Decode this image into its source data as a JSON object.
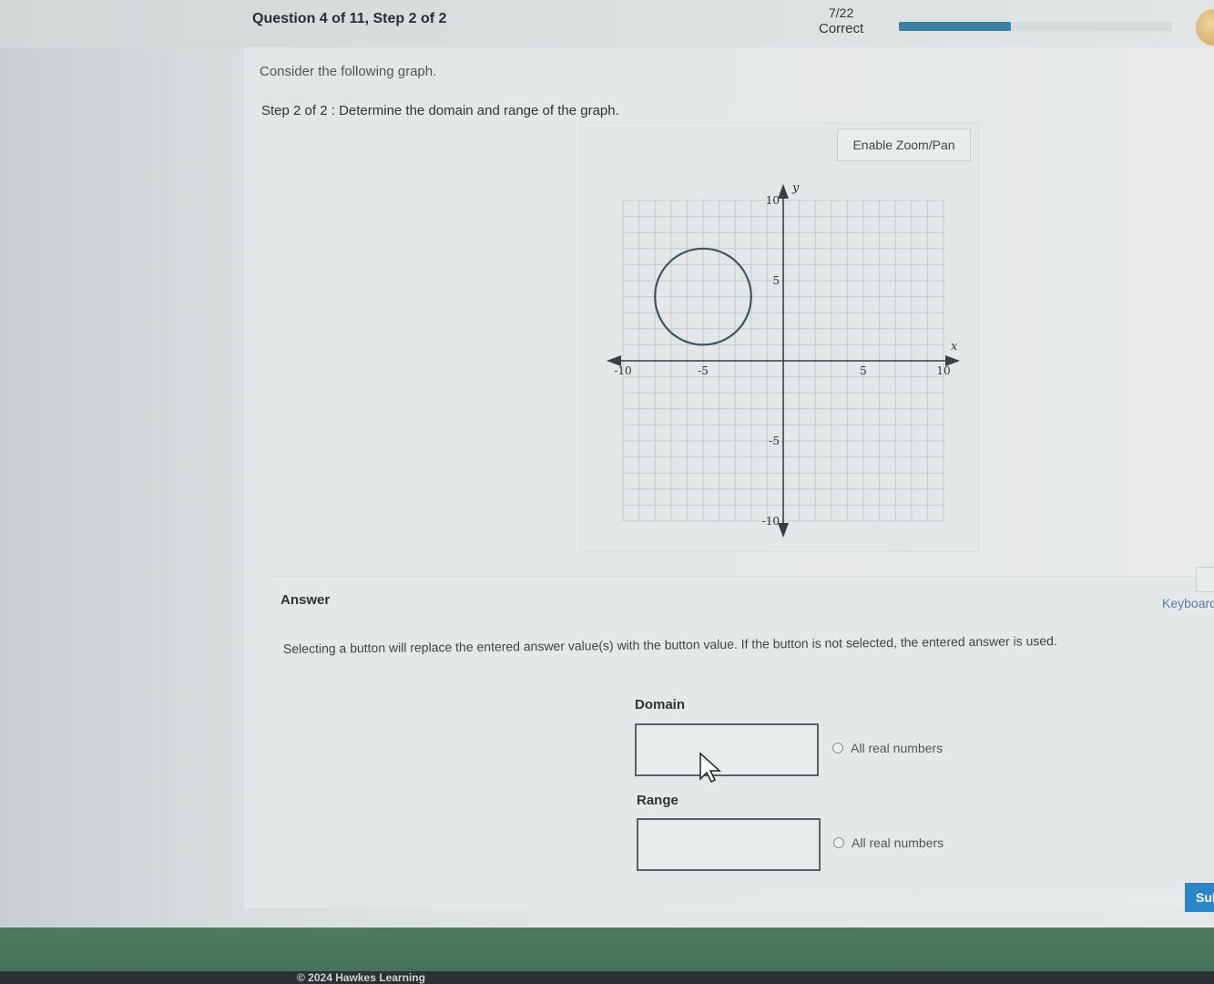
{
  "header": {
    "question_title": "Question 4 of 11, Step 2 of 2",
    "progress_fraction": "7/22",
    "progress_status": "Correct",
    "progress_value": 0.41
  },
  "question": {
    "prompt": "Consider the following graph.",
    "step_prefix": "Step 2 of 2 :",
    "step_text": "Determine the domain and range of the graph."
  },
  "graph": {
    "zoom_button": "Enable Zoom/Pan",
    "x_axis_label": "x",
    "y_axis_label": "y",
    "x_tick_labels": [
      "-10",
      "-5",
      "5",
      "10"
    ],
    "y_tick_labels": [
      "10",
      "5",
      "-5",
      "-10"
    ],
    "x_range": [
      -10,
      10
    ],
    "y_range": [
      -10,
      10
    ],
    "grid": true,
    "circle": {
      "center_x": -5,
      "center_y": 4,
      "radius": 3
    }
  },
  "answer": {
    "heading": "Answer",
    "keyboard_label": "Keyboard",
    "instruction": "Selecting a button will replace the entered answer value(s) with the button value. If the button is not selected, the entered answer is used.",
    "domain_label": "Domain",
    "domain_value": "",
    "domain_option": "All real numbers",
    "range_label": "Range",
    "range_value": "",
    "range_option": "All real numbers",
    "submit_label": "Sub"
  },
  "footer": {
    "copyright": "© 2024 Hawkes Learning"
  },
  "colors": {
    "progress_fill": "#3b7fa3",
    "submit": "#2a86c7",
    "footer": "#4f7b62"
  }
}
